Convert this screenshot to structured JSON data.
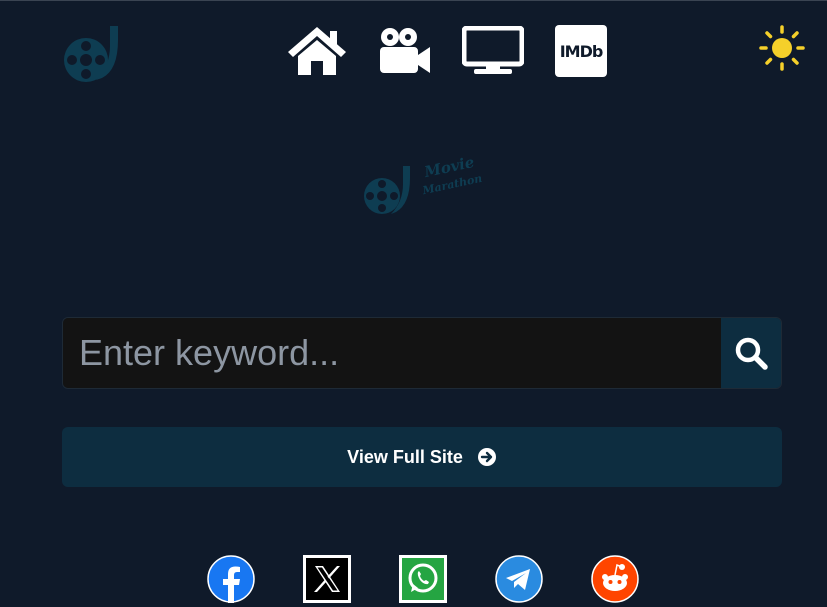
{
  "header": {
    "brand_icon": "film-reel-icon",
    "nav": [
      {
        "name": "home",
        "icon": "home-icon"
      },
      {
        "name": "movies",
        "icon": "video-camera-icon"
      },
      {
        "name": "tv",
        "icon": "tv-monitor-icon"
      },
      {
        "name": "imdb",
        "label": "IMDb"
      }
    ],
    "theme_icon": "sun-icon"
  },
  "logo": {
    "line1": "Movie",
    "line2": "Marathon"
  },
  "search": {
    "placeholder": "Enter keyword...",
    "value": "",
    "icon": "search-icon"
  },
  "view_full_site": {
    "label": "View Full Site",
    "icon": "arrow-circle-right-icon"
  },
  "share": [
    "facebook",
    "x",
    "whatsapp",
    "telegram",
    "reddit"
  ],
  "colors": {
    "background": "#0f1a2a",
    "accent": "#0d2d40",
    "logo": "#0e3d52",
    "sun": "#f5d02a"
  }
}
